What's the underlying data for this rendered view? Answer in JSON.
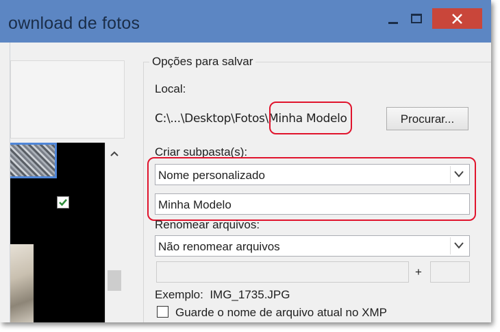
{
  "window": {
    "title": "ownload de fotos",
    "controls": {
      "minimize": "minimize-icon",
      "maximize": "maximize-icon",
      "close": "close-icon"
    },
    "accent_color": "#5c86c3",
    "close_color": "#c9463a"
  },
  "left_pane": {
    "thumbnail_checked": true,
    "scroll_icon": "chevron-up-icon"
  },
  "save_options": {
    "group_title": "Opções para salvar",
    "local_label": "Local:",
    "path_prefix": "C:\\...\\Desktop\\Fotos",
    "path_highlight": "\\Minha Modelo",
    "browse_button": "Procurar...",
    "subfolder_label": "Criar subpasta(s):",
    "subfolder_select": "Nome personalizado",
    "subfolder_name": "Minha Modelo",
    "rename_label": "Renomear arquivos:",
    "rename_select": "Não renomear arquivos",
    "plus_sign": "+",
    "example_label": "Exemplo:",
    "example_value": "IMG_1735.JPG",
    "keep_name_checkbox": "Guarde o nome de arquivo atual no XMP",
    "keep_name_checked": false,
    "highlight_color": "#e0132c"
  }
}
